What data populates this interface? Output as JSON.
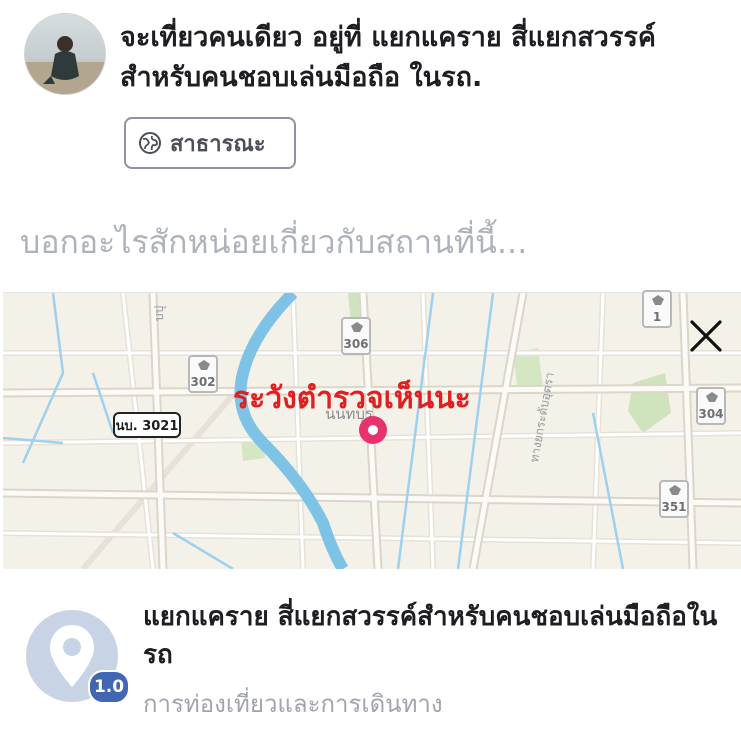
{
  "post": {
    "title": "จะเที่ยวคนเดียว อยู่ที่ แยกแคราย สี่แยกสวรรค์สำหรับคนชอบเล่นมือถือ ในรถ.",
    "privacy_label": "สาธารณะ"
  },
  "composer": {
    "placeholder": "บอกอะไรสักหน่อยเกี่ยวกับสถานที่นี้..."
  },
  "map": {
    "warning_text": "ระวังตำรวจเห็นนะ",
    "district_label": "นนทบุร",
    "route_label": "นบ. 3021",
    "highway_shields": [
      "306",
      "302",
      "1",
      "304",
      "351"
    ],
    "pin_color": "#e8326e"
  },
  "place": {
    "name": "แยกแคราย สี่แยกสวรรค์สำหรับคนชอบเล่นมือถือในรถ",
    "rating": "1.0",
    "category": "การท่องเที่ยวและการเดินทาง"
  }
}
